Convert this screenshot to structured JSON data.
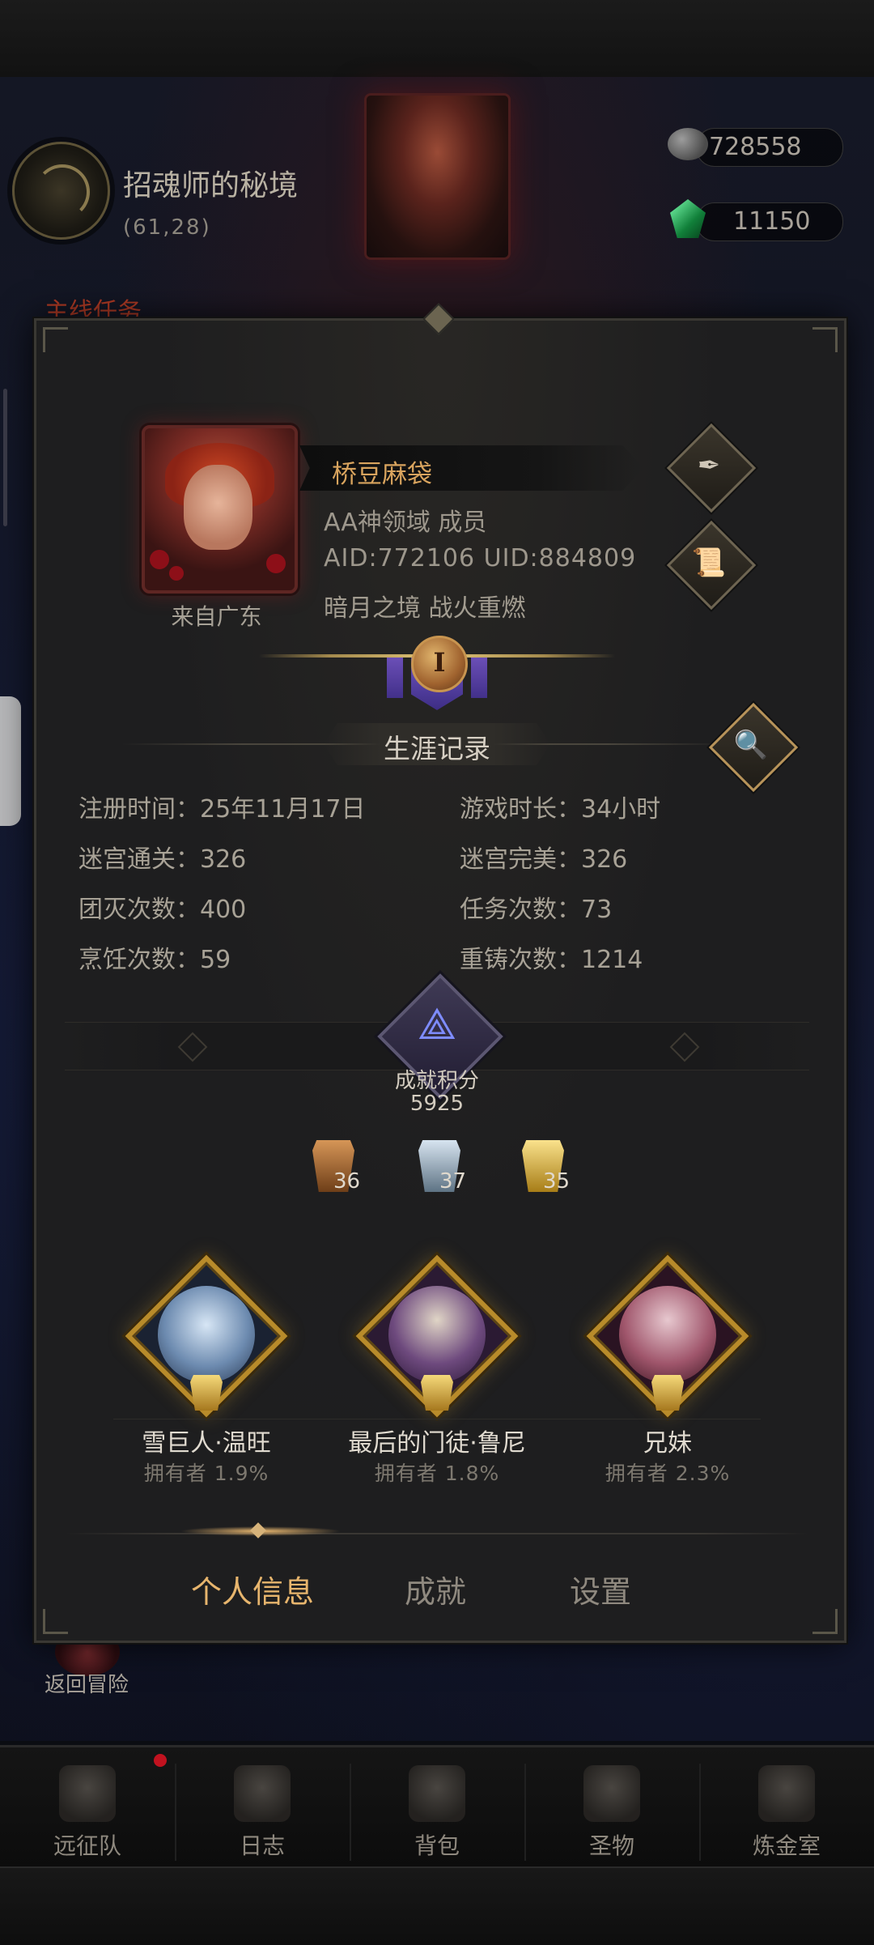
{
  "location": {
    "name": "招魂师的秘境",
    "coords": "(61,28)"
  },
  "currency": {
    "stone": "728558",
    "gem": "11150"
  },
  "quest": {
    "label": "主线任务"
  },
  "back_adventure": {
    "label": "返回冒险"
  },
  "nav": {
    "items": [
      {
        "label": "远征队",
        "icon": "helmet-icon",
        "has_dot": true
      },
      {
        "label": "日志",
        "icon": "journal-icon"
      },
      {
        "label": "背包",
        "icon": "backpack-icon"
      },
      {
        "label": "圣物",
        "icon": "relic-icon"
      },
      {
        "label": "炼金室",
        "icon": "alchemy-icon"
      }
    ]
  },
  "profile": {
    "name": "桥豆麻袋",
    "guild": "AA神领域  成员",
    "ids": "AID:772106 UID:884809",
    "motto": "暗月之境  战火重燃",
    "from": "来自广东",
    "rank_numeral": "I"
  },
  "career": {
    "title": "生涯记录",
    "stats": [
      {
        "label": "注册时间：",
        "value": "25年11月17日"
      },
      {
        "label": "游戏时长：",
        "value": "34小时"
      },
      {
        "label": "迷宫通关：",
        "value": "326"
      },
      {
        "label": "迷宫完美：",
        "value": "326"
      },
      {
        "label": "团灭次数：",
        "value": "400"
      },
      {
        "label": "任务次数：",
        "value": "73"
      },
      {
        "label": "烹饪次数：",
        "value": "59"
      },
      {
        "label": "重铸次数：",
        "value": "1214"
      }
    ]
  },
  "achievement": {
    "label": "成就积分",
    "score": "5925",
    "badges": [
      {
        "tier": "bronze",
        "count": "36",
        "color": "#b8743a"
      },
      {
        "tier": "silver",
        "count": "37",
        "color": "#9fb3c6"
      },
      {
        "tier": "gold",
        "count": "35",
        "color": "#e0b93e"
      }
    ]
  },
  "trophies": [
    {
      "name": "雪巨人·温旺",
      "owners": "拥有者  1.9%"
    },
    {
      "name": "最后的门徒·鲁尼",
      "owners": "拥有者  1.8%"
    },
    {
      "name": "兄妹",
      "owners": "拥有者  2.3%"
    }
  ],
  "tabs": [
    {
      "label": "个人信息",
      "active": true
    },
    {
      "label": "成就"
    },
    {
      "label": "设置"
    }
  ]
}
